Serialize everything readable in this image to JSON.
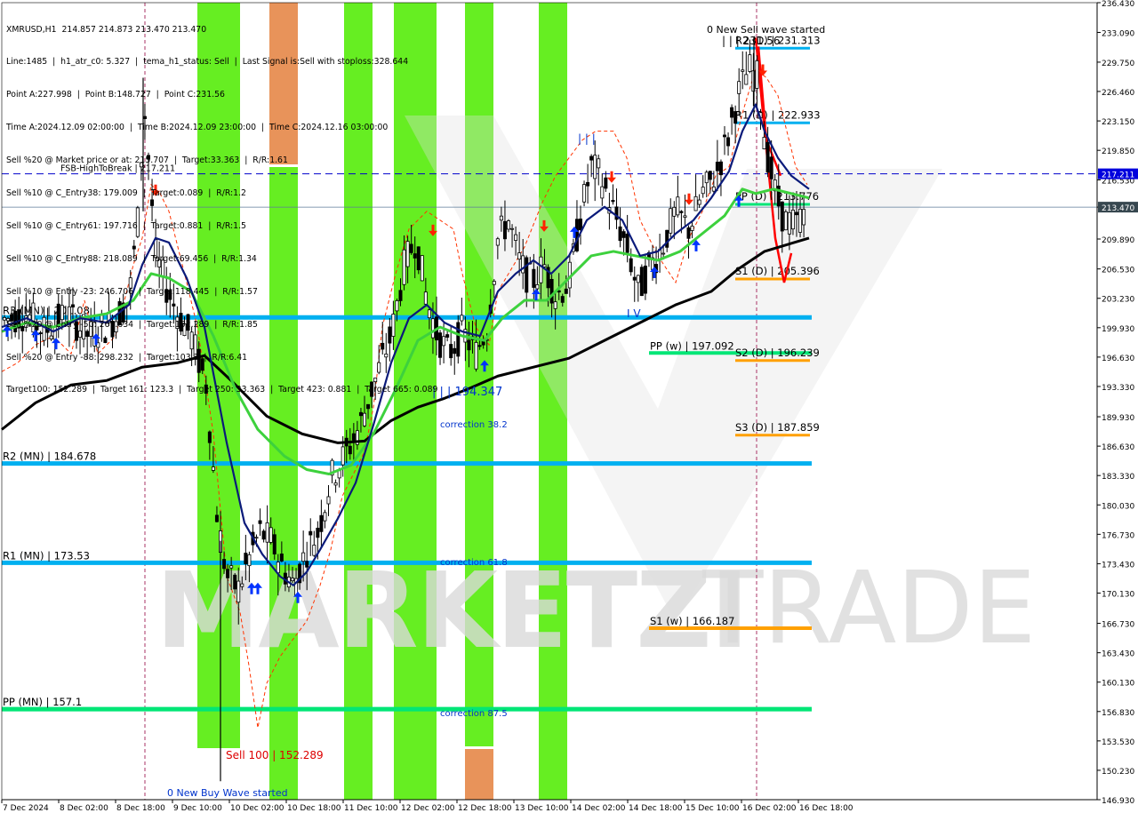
{
  "header": {
    "title": "XMRUSD,H1  214.857 214.873 213.470 213.470",
    "lines": [
      "Line:1485  |  h1_atr_c0: 5.327  |  tema_h1_status: Sell  |  Last Signal is:Sell with stoploss:328.644",
      "Point A:227.998  |  Point B:148.727  |  Point C:231.56",
      "Time A:2024.12.09 02:00:00  |  Time B:2024.12.09 23:00:00  |  Time C:2024.12.16 03:00:00",
      "Sell %20 @ Market price or at: 215.707  |  Target:33.363  |  R/R:1.61",
      "Sell %10 @ C_Entry38: 179.009  |  Target:0.089  |  R/R:1.2",
      "Sell %10 @ C_Entry61: 197.716  |  Target:0.881  |  R/R:1.5",
      "Sell %10 @ C_Entry88: 218.089  |  Target:69.456  |  R/R:1.34",
      "Sell %10 @ Entry -23: 246.706  |  Target:118.445  |  R/R:1.57",
      "Sell %20 @ Entry -50: 267.634  |  Target:152.289  |  R/R:1.85",
      "Sell %20 @ Entry -88: 298.232  |  Target:103.3  |  R/R:6.41",
      "Target100: 152.289  |  Target 161: 123.3  |  Target 250: 33.363  |  Target 423: 0.881  |  Target 665: 0.089"
    ]
  },
  "watermark": {
    "text_a": "MARKETZI",
    "text_b": "TRADE"
  },
  "colors": {
    "background": "#ffffff",
    "axis": "#000000",
    "green_band": "#66ee22",
    "orange_band": "#e8935a",
    "monthly_level": "#00b0f0",
    "weekly_pp": "#00e676",
    "weekly_s1": "#ffa000",
    "daily_level": "#ffa000",
    "daily_r1": "#00b0f0",
    "fsb_line": "#0000cc",
    "current_price_line": "#5d7a99",
    "price_tag": "#37474f",
    "fsb_tag": "#0000dd",
    "candle_bull": "#000000",
    "candle_bear": "#000000",
    "navy_ma": "#0a1a7a",
    "green_ma": "#3dd13d",
    "black_ma": "#000000",
    "red_dashed": "#ff3300",
    "wave_red": "#ff0000",
    "buy_arrow": "#0033ff",
    "sell_arrow": "#ff2200",
    "label_blue": "#0033cc",
    "label_red": "#dd0000"
  },
  "chart_data": {
    "type": "candlestick",
    "symbol": "XMRUSD",
    "timeframe": "H1",
    "ylim": [
      146.93,
      236.43
    ],
    "y_ticks": [
      "236.430",
      "233.090",
      "229.750",
      "226.460",
      "223.150",
      "219.850",
      "216.530",
      "213.470",
      "209.890",
      "206.530",
      "203.230",
      "199.930",
      "196.630",
      "193.330",
      "189.930",
      "186.630",
      "183.330",
      "180.030",
      "176.730",
      "173.430",
      "170.130",
      "166.730",
      "163.430",
      "160.130",
      "156.830",
      "153.530",
      "150.230",
      "146.930"
    ],
    "x_labels": [
      "7 Dec 2024",
      "8 Dec 02:00",
      "8 Dec 18:00",
      "9 Dec 10:00",
      "10 Dec 02:00",
      "10 Dec 18:00",
      "11 Dec 10:00",
      "12 Dec 02:00",
      "12 Dec 18:00",
      "13 Dec 10:00",
      "14 Dec 02:00",
      "14 Dec 18:00",
      "15 Dec 10:00",
      "16 Dec 02:00",
      "16 Dec 18:00"
    ],
    "current_price": {
      "value": 213.47,
      "label": "213.470"
    },
    "fsb_high": {
      "value": 217.211,
      "label": "FSB-HighToBreak | 217.211",
      "tag": "217.211"
    },
    "levels": [
      {
        "name": "R3 (MN) | 201.08",
        "value": 201.08,
        "kind": "monthly"
      },
      {
        "name": "R2 (MN) | 184.678",
        "value": 184.678,
        "kind": "monthly"
      },
      {
        "name": "R1 (MN) | 173.53",
        "value": 173.53,
        "kind": "monthly"
      },
      {
        "name": "PP (MN) | 157.1",
        "value": 157.1,
        "kind": "monthly_pp"
      },
      {
        "name": "PP (w) | 197.092",
        "value": 197.092,
        "kind": "weekly_pp"
      },
      {
        "name": "S1 (w) | 166.187",
        "value": 166.187,
        "kind": "weekly_s1"
      },
      {
        "name": "R2 (D) | 231.313",
        "value": 231.313,
        "kind": "daily_r"
      },
      {
        "name": "R1 (D) | 222.933",
        "value": 222.933,
        "kind": "daily_r"
      },
      {
        "name": "PP (D) | 213.776",
        "value": 213.776,
        "kind": "daily_pp"
      },
      {
        "name": "S1 (D) | 205.396",
        "value": 205.396,
        "kind": "daily_s"
      },
      {
        "name": "S2 (D) | 196.239",
        "value": 196.239,
        "kind": "daily_s"
      },
      {
        "name": "S3 (D) | 187.859",
        "value": 187.859,
        "kind": "daily_s"
      }
    ],
    "annotations": [
      {
        "text": "0 New Sell wave started",
        "x": 1.195,
        "y": 233.5,
        "color": "black"
      },
      {
        "text": "| | | 194.347",
        "x": 0.27,
        "y": 193.9,
        "color": "blue"
      },
      {
        "text": "correction 38.2",
        "x": 0.27,
        "y": 189.2,
        "color": "blue"
      },
      {
        "text": "correction 61.8",
        "x": 0.27,
        "y": 173.5,
        "color": "blue"
      },
      {
        "text": "correction 87.5",
        "x": 0.27,
        "y": 156.4,
        "color": "blue"
      },
      {
        "text": "Sell 100 | 152.289",
        "x": 0.09,
        "y": 152.3,
        "color": "red"
      },
      {
        "text": "0 New Buy Wave started",
        "x": 0.09,
        "y": 148.0,
        "color": "blue"
      },
      {
        "text": "| | |",
        "x": 0.93,
        "y": 221.5,
        "color": "blue"
      },
      {
        "text": "I V",
        "x": 1.0,
        "y": 202.2,
        "color": "blue"
      },
      {
        "text": "| | | 231.56",
        "x": 1.175,
        "y": 231.8,
        "color": "black"
      }
    ],
    "green_bands": [
      [
        0.065,
        0.115
      ],
      [
        0.175,
        0.22
      ],
      [
        0.225,
        0.275
      ],
      [
        0.32,
        0.355
      ],
      [
        0.385,
        0.42
      ],
      [
        0.54,
        0.58
      ],
      [
        0.635,
        0.675
      ],
      [
        0.705,
        0.745
      ]
    ],
    "orange_bands": [
      [
        0.3,
        0.33
      ],
      [
        0.32,
        0.35
      ]
    ]
  }
}
